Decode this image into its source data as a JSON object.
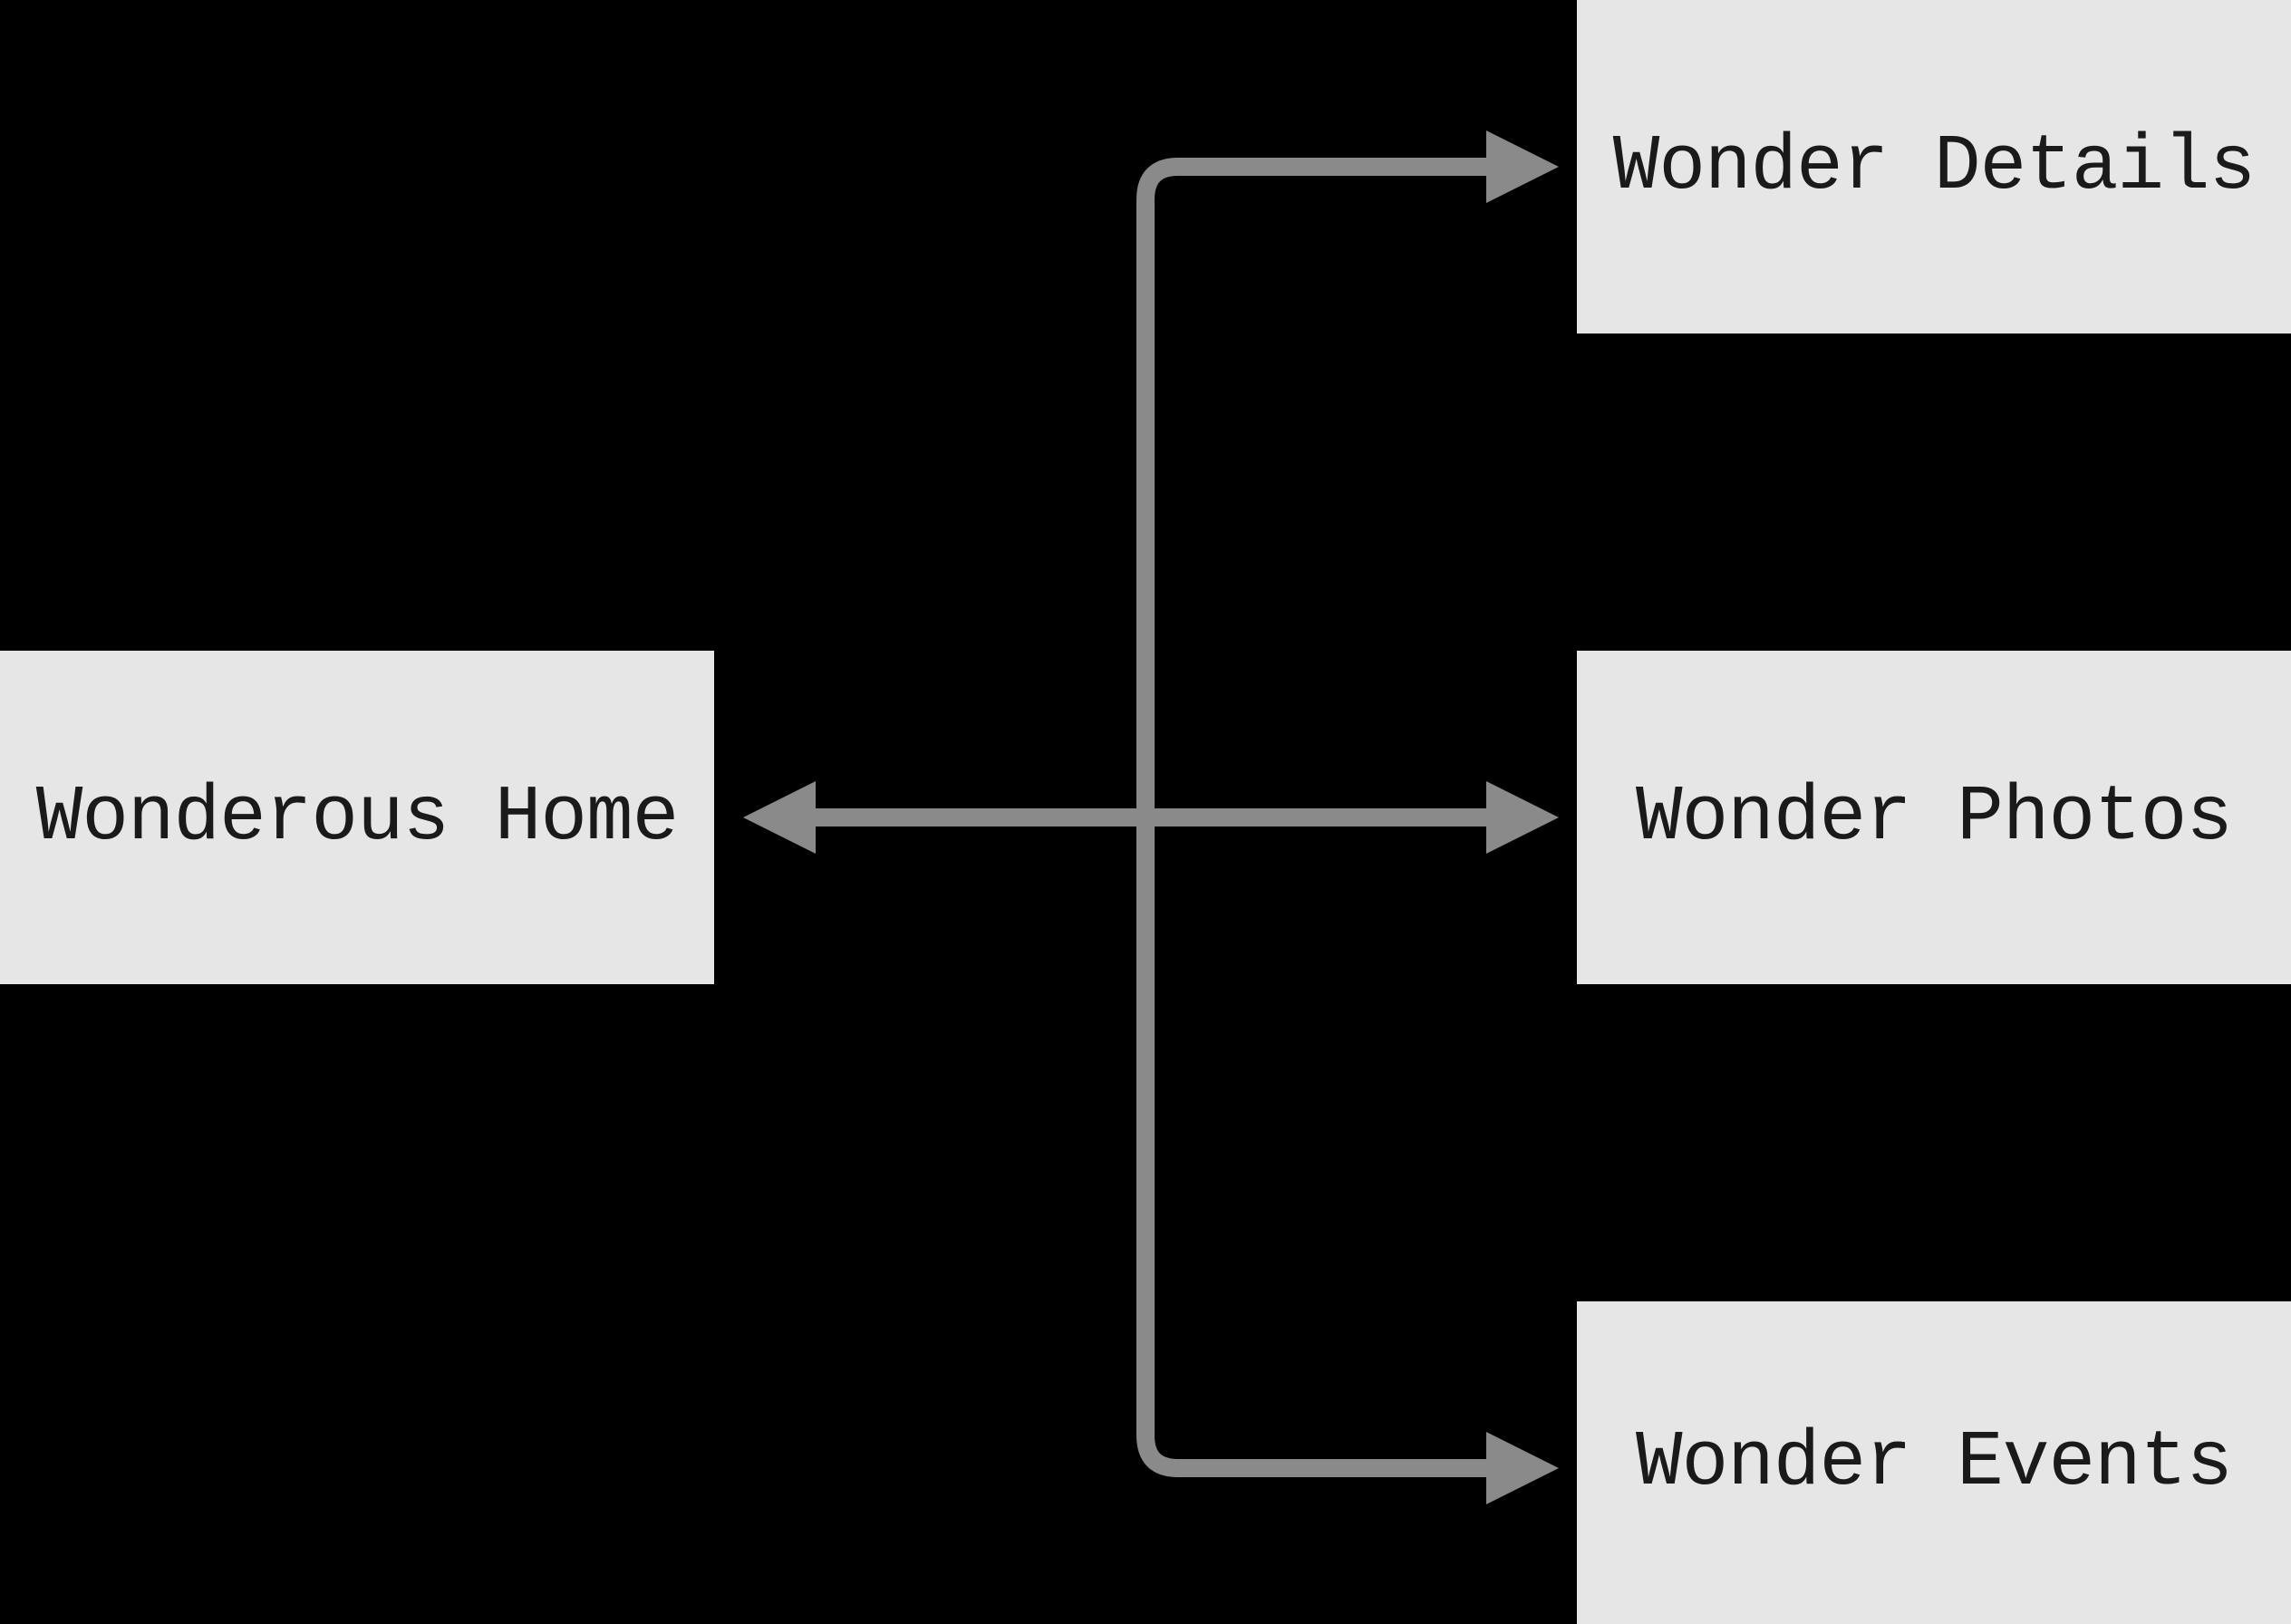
{
  "diagram": {
    "source_node": {
      "label": "Wonderous Home"
    },
    "target_nodes": [
      {
        "label": "Wonder Details"
      },
      {
        "label": "Wonder Photos"
      },
      {
        "label": "Wonder Events"
      }
    ],
    "edges": [
      {
        "from": "Wonderous Home",
        "to": "Wonder Details"
      },
      {
        "from": "Wonderous Home",
        "to": "Wonder Photos",
        "bidirectional": true
      },
      {
        "from": "Wonderous Home",
        "to": "Wonder Events"
      }
    ]
  }
}
